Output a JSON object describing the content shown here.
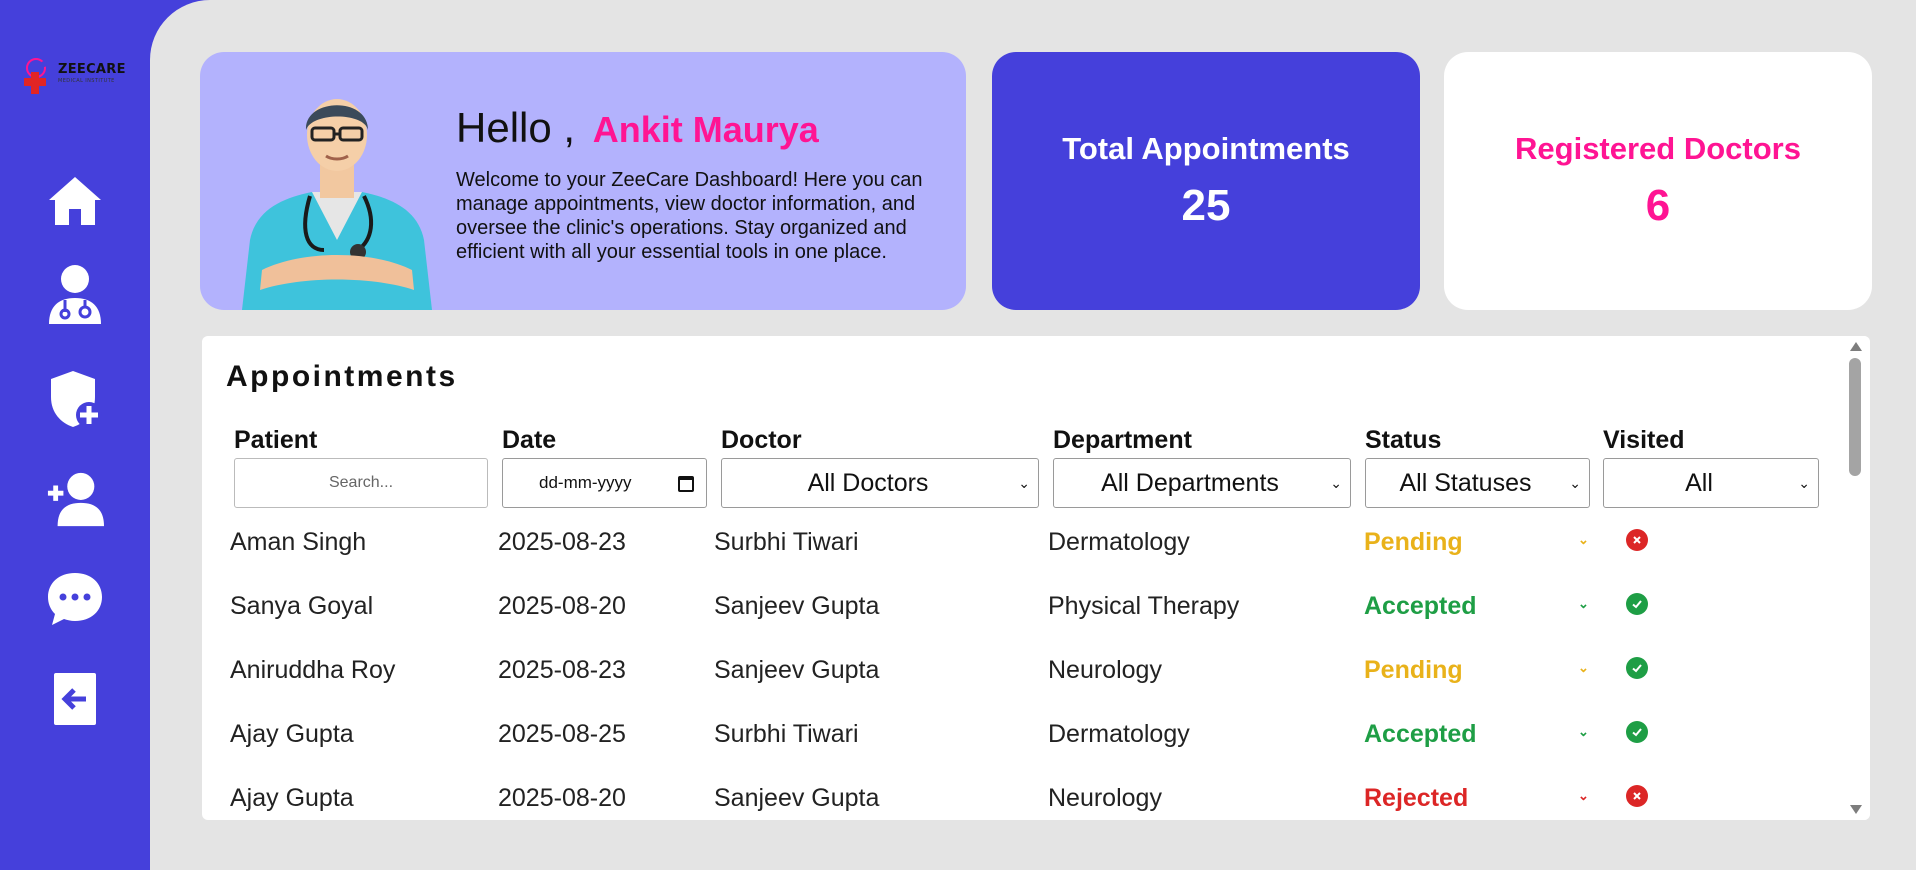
{
  "brand": {
    "name": "ZEECARE",
    "tagline": "MEDICAL INSTITUTE"
  },
  "sidebar": {
    "items": [
      {
        "icon": "home-icon"
      },
      {
        "icon": "doctors-icon"
      },
      {
        "icon": "add-admin-icon"
      },
      {
        "icon": "add-doctor-icon"
      },
      {
        "icon": "messages-icon"
      },
      {
        "icon": "logout-icon"
      }
    ]
  },
  "welcome": {
    "greeting": "Hello ,",
    "name": "Ankit Maurya",
    "message": "Welcome to your ZeeCare Dashboard! Here you can manage appointments, view doctor information, and oversee the clinic's operations. Stay organized and efficient with all your essential tools in one place."
  },
  "stats": {
    "appointments_label": "Total Appointments",
    "appointments_value": "25",
    "doctors_label": "Registered Doctors",
    "doctors_value": "6"
  },
  "appointments": {
    "title": "Appointments",
    "columns": {
      "patient": "Patient",
      "date": "Date",
      "doctor": "Doctor",
      "department": "Department",
      "status": "Status",
      "visited": "Visited"
    },
    "filters": {
      "patient_placeholder": "Search...",
      "date_placeholder": "dd-mm-yyyy",
      "doctor": "All Doctors",
      "department": "All Departments",
      "status": "All Statuses",
      "visited": "All"
    },
    "rows": [
      {
        "patient": "Aman Singh",
        "date": "2025-08-23",
        "doctor": "Surbhi Tiwari",
        "department": "Dermatology",
        "status": "Pending",
        "visited": false
      },
      {
        "patient": "Sanya Goyal",
        "date": "2025-08-20",
        "doctor": "Sanjeev Gupta",
        "department": "Physical Therapy",
        "status": "Accepted",
        "visited": true
      },
      {
        "patient": "Aniruddha Roy",
        "date": "2025-08-23",
        "doctor": "Sanjeev Gupta",
        "department": "Neurology",
        "status": "Pending",
        "visited": true
      },
      {
        "patient": "Ajay Gupta",
        "date": "2025-08-25",
        "doctor": "Surbhi Tiwari",
        "department": "Dermatology",
        "status": "Accepted",
        "visited": true
      },
      {
        "patient": "Ajay Gupta",
        "date": "2025-08-20",
        "doctor": "Sanjeev Gupta",
        "department": "Neurology",
        "status": "Rejected",
        "visited": false
      }
    ]
  },
  "colors": {
    "brand": "#4540db",
    "accent": "#ff1493",
    "card_bg": "#b3b2fd",
    "pending": "#e9b21a",
    "accepted": "#1e9e45",
    "rejected": "#dc2626"
  }
}
